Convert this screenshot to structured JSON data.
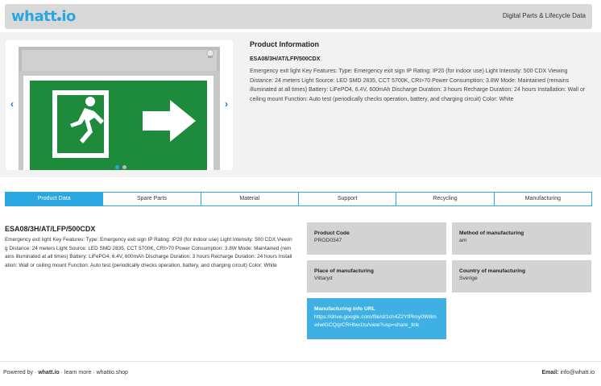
{
  "header": {
    "logo": "whatt",
    "logo_suffix": "io",
    "title": "Digital Parts & Lifecycle Data"
  },
  "carousel": {
    "prev": "‹",
    "next": "›",
    "dots": 2,
    "active_dot": 0
  },
  "product_info": {
    "heading": "Product Information",
    "code": "ESA08/3H/AT/LFP/500CDX",
    "description": "Emergency exit light Key Features: Type: Emergency exit sign IP Rating: IP20 (for indoor use) Light Intensity: 500 CDX Viewing Distance: 24 meters Light Source: LED SMD 2835, CCT 5700K, CRI>70 Power Consumption: 3.8W Mode: Maintained (remains illuminated at all times) Battery: LiFePO4, 6.4V, 600mAh Discharge Duration: 3 hours Recharge Duration: 24 hours Installation: Wall or ceiling mount Function: Auto test (periodically checks operation, battery, and charging circuit) Color: White"
  },
  "tabs": [
    {
      "label": "Product Data",
      "active": true
    },
    {
      "label": "Spare Parts",
      "active": false
    },
    {
      "label": "Material",
      "active": false
    },
    {
      "label": "Support",
      "active": false
    },
    {
      "label": "Recycling",
      "active": false
    },
    {
      "label": "Manufacturing",
      "active": false
    }
  ],
  "main": {
    "code": "ESA08/3H/AT/LFP/500CDX",
    "description": "Emergency exit light Key Features: Type: Emergency exit sign IP Rating: IP20 (for indoor use) Light Intensity: 500 CDX Viewing Distance: 24 meters Light Source: LED SMD 2835, CCT 5700K, CRI>70 Power Consumption: 3.8W Mode: Maintained (remains illuminated at all times) Battery: LiFePO4, 6.4V, 600mAh Discharge Duration: 3 hours Recharge Duration: 24 hours Installation: Wall or ceiling mount Function: Auto test (periodically checks operation, battery, and charging circuit) Color: White"
  },
  "cards": {
    "product_code": {
      "label": "Product Code",
      "value": "PROD0347"
    },
    "method": {
      "label": "Method of manufacturing",
      "value": "am"
    },
    "place": {
      "label": "Place of manufacturing",
      "value": "Vittaryd"
    },
    "country": {
      "label": "Country of manufacturing",
      "value": "Sverige"
    },
    "url": {
      "label": "Manufacturing info URL",
      "value": "https://drive.google.com/file/d/1ch4Z2YfPlmy0W8mwiwlGCQqrCRHbw1tu/view?usp=share_link"
    }
  },
  "footer": {
    "powered_by": "Powered by ·",
    "brand": "whatt.io",
    "links": "· learn more · whattio.shop",
    "email_label": "Email:",
    "email": "info@whatt.io"
  },
  "colors": {
    "accent": "#2aa7e0",
    "sign_green": "#1e8a3c",
    "card_gray": "#d3d3d3"
  }
}
